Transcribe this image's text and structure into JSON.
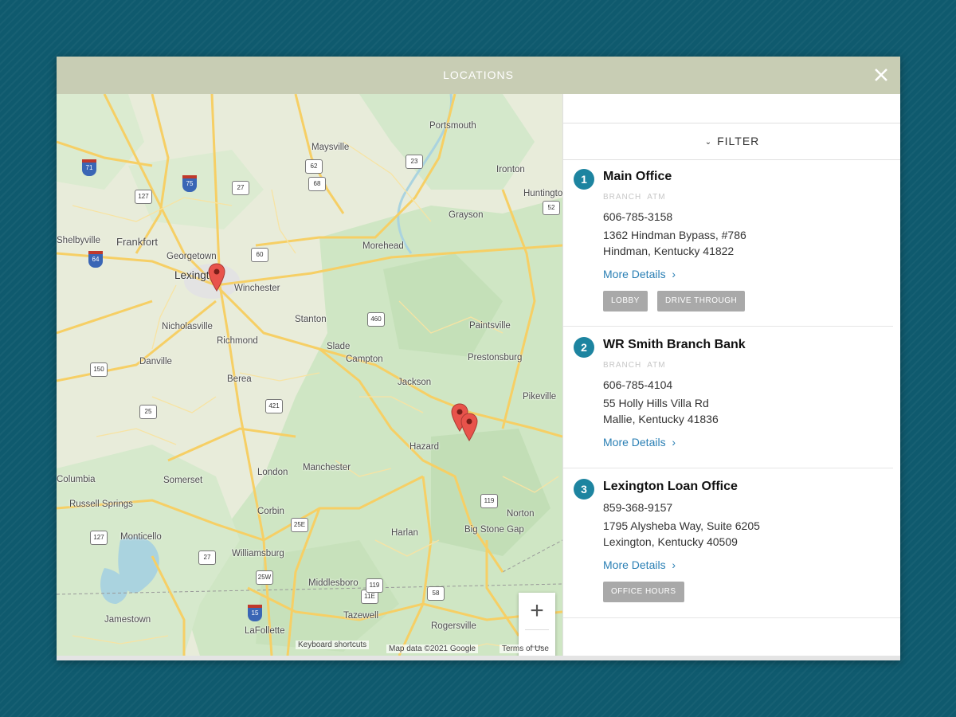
{
  "modal": {
    "title": "LOCATIONS",
    "close_icon": "close-icon"
  },
  "filter": {
    "label": "FILTER",
    "icon": "chevron-down-icon"
  },
  "map": {
    "places": [
      "Portsmouth",
      "Maysville",
      "Ironton",
      "Huntington",
      "Frankfort",
      "Shelbyville",
      "Georgetown",
      "Lexington",
      "Winchester",
      "Morehead",
      "Grayson",
      "Nicholasville",
      "Richmond",
      "Stanton",
      "Paintsville",
      "Slade",
      "Campton",
      "Prestonsburg",
      "Danville",
      "Berea",
      "Jackson",
      "Pikeville",
      "Hazard",
      "London",
      "Manchester",
      "Somerset",
      "Russell Springs",
      "Columbia",
      "Corbin",
      "Monticello",
      "Williamsburg",
      "Harlan",
      "Big Stone Gap",
      "Norton",
      "Middlesboro",
      "Tazewell",
      "Jamestown",
      "LaFollette",
      "Rogersville"
    ],
    "highways": [
      "71",
      "75",
      "127",
      "27",
      "62",
      "68",
      "23",
      "52",
      "64",
      "460",
      "60",
      "421",
      "150",
      "25",
      "119",
      "58",
      "25E",
      "127",
      "27",
      "25W",
      "11E",
      "15",
      "119"
    ],
    "zoom_in_label": "+",
    "zoom_out_label": "−",
    "google_logo": "Google",
    "keyboard_shortcuts": "Keyboard shortcuts",
    "map_data": "Map data ©2021 Google",
    "terms": "Terms of Use",
    "marker_count": 3
  },
  "locations": [
    {
      "num": "1",
      "name": "Main Office",
      "tags": "BRANCH  ATM",
      "phone": "606-785-3158",
      "address1": "1362 Hindman Bypass, #786",
      "address2": "Hindman, Kentucky 41822",
      "details": "More Details",
      "buttons": [
        "LOBBY",
        "DRIVE THROUGH"
      ]
    },
    {
      "num": "2",
      "name": "WR Smith Branch Bank",
      "tags": "BRANCH  ATM",
      "phone": "606-785-4104",
      "address1": "55 Holly Hills Villa Rd",
      "address2": "Mallie, Kentucky 41836",
      "details": "More Details",
      "buttons": []
    },
    {
      "num": "3",
      "name": "Lexington Loan Office",
      "tags": "",
      "phone": "859-368-9157",
      "address1": "1795 Alysheba Way, Suite 6205",
      "address2": "Lexington, Kentucky 40509",
      "details": "More Details",
      "buttons": [
        "OFFICE HOURS"
      ]
    }
  ],
  "colors": {
    "background": "#0f5a6e",
    "header": "#c8cdb4",
    "accent": "#1d84a0",
    "link": "#2a7fb4",
    "pill": "#a9a9a9",
    "marker": "#e8534b"
  }
}
